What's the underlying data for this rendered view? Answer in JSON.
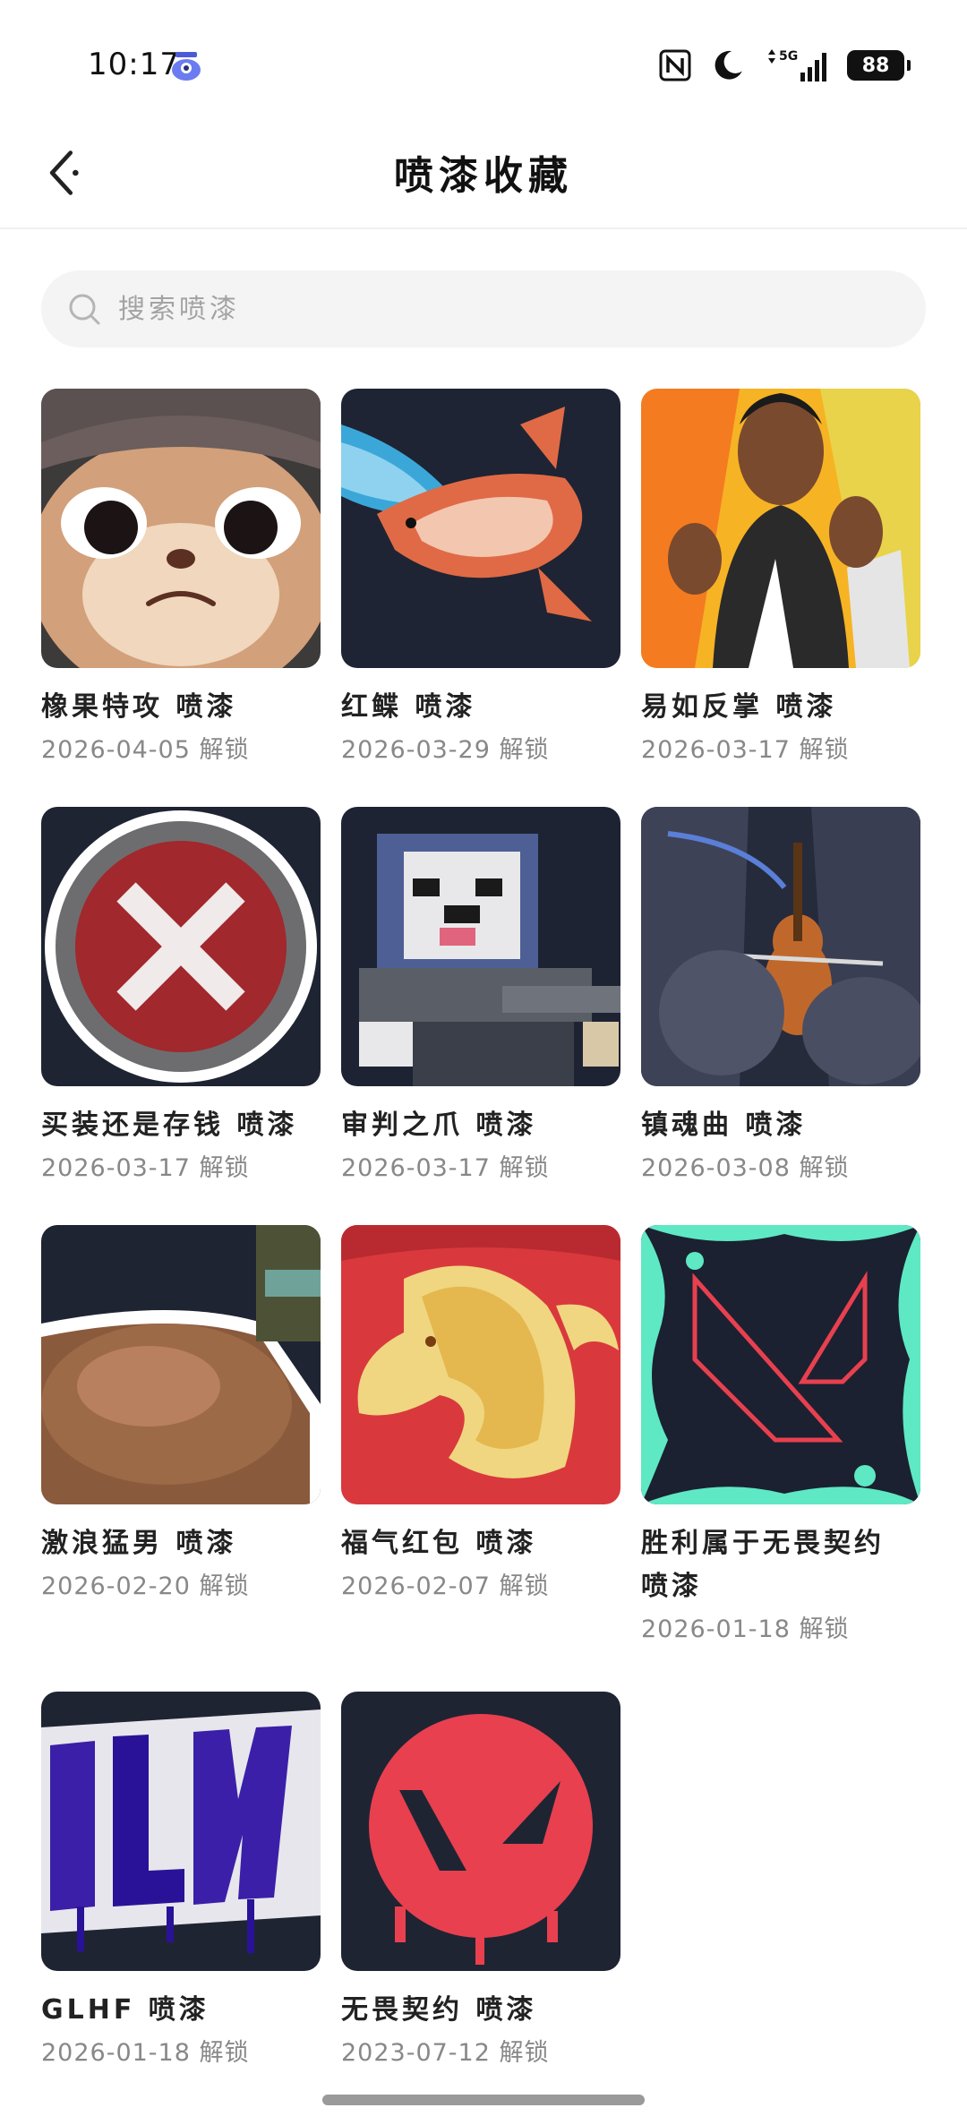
{
  "status_bar": {
    "time": "10:17",
    "network": "5G",
    "battery": "88",
    "icons": [
      "app-notification-icon",
      "nfc-icon",
      "moon-icon",
      "signal-5g-icon",
      "battery-icon"
    ]
  },
  "header": {
    "title": "喷漆收藏",
    "back_icon": "chevron-left-icon"
  },
  "search": {
    "placeholder": "搜索喷漆",
    "icon": "search-icon"
  },
  "sprays": [
    {
      "name": "橡果特攻 喷漆",
      "date": "2026-04-05",
      "action": "解锁",
      "art": "squirrel"
    },
    {
      "name": "红鲽 喷漆",
      "date": "2026-03-29",
      "action": "解锁",
      "art": "koi"
    },
    {
      "name": "易如反掌 喷漆",
      "date": "2026-03-17",
      "action": "解锁",
      "art": "agent"
    },
    {
      "name": "买装还是存钱 喷漆",
      "date": "2026-03-17",
      "action": "解锁",
      "art": "x-button"
    },
    {
      "name": "审判之爪 喷漆",
      "date": "2026-03-17",
      "action": "解锁",
      "art": "pixel-sloth"
    },
    {
      "name": "镇魂曲 喷漆",
      "date": "2026-03-08",
      "action": "解锁",
      "art": "violin"
    },
    {
      "name": "激浪猛男 喷漆",
      "date": "2026-02-20",
      "action": "解锁",
      "art": "muscle"
    },
    {
      "name": "福气红包 喷漆",
      "date": "2026-02-07",
      "action": "解锁",
      "art": "horse"
    },
    {
      "name": "胜利属于无畏契约 喷漆",
      "date": "2026-01-18",
      "action": "解锁",
      "art": "valorant-splash"
    },
    {
      "name": "GLHF 喷漆",
      "date": "2026-01-18",
      "action": "解锁",
      "art": "glhf"
    },
    {
      "name": "无畏契约 喷漆",
      "date": "2023-07-12",
      "action": "解锁",
      "art": "valorant-red"
    }
  ],
  "colors": {
    "accent_red": "#e8404f",
    "dark_navy": "#1f2433",
    "teal": "#5ee8c4"
  }
}
